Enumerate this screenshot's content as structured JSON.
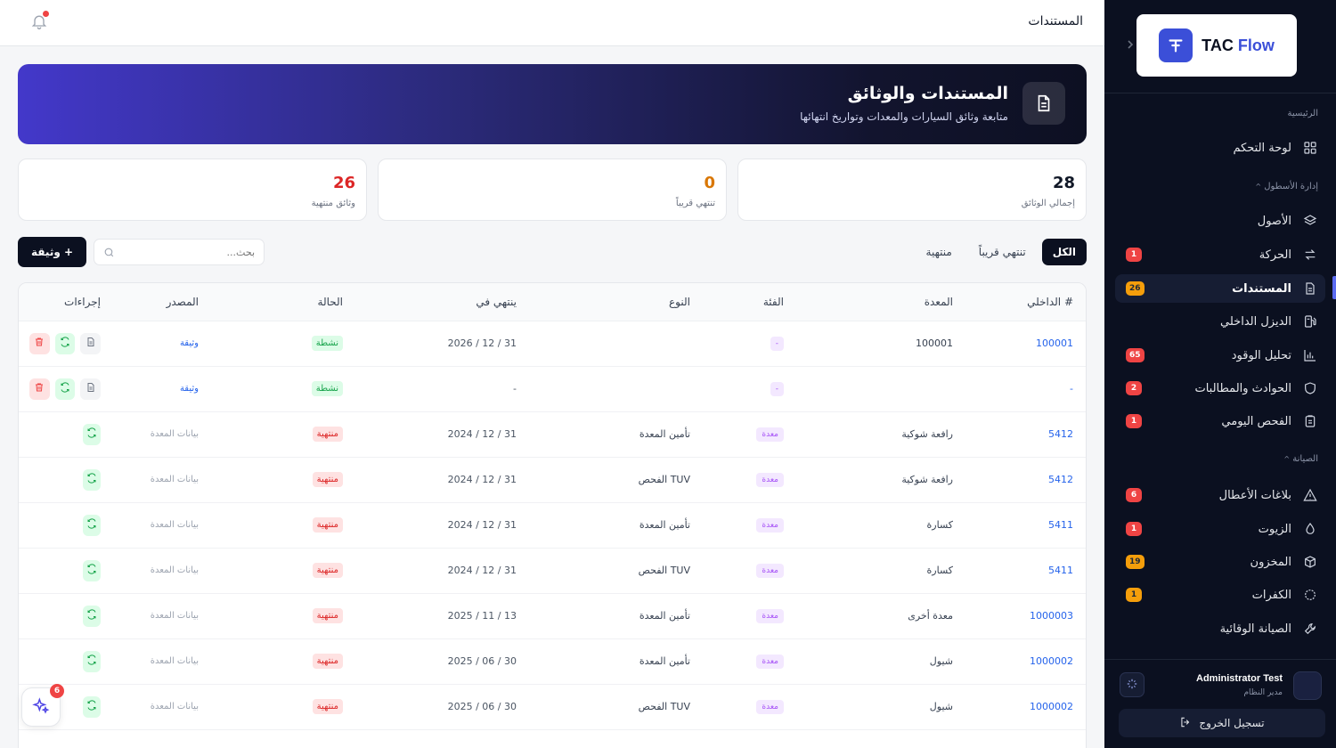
{
  "sidebar": {
    "logo": {
      "brand": "TAC",
      "product": "Flow"
    },
    "sections": {
      "home": "الرئيسية",
      "fleet": "إدارة الأسطول",
      "maintenance": "الصيانة"
    },
    "items": [
      {
        "label": "لوحة التحكم",
        "badge": "",
        "icon": "dashboard-icon"
      },
      {
        "label": "الأصول",
        "badge": "",
        "icon": "layers-icon"
      },
      {
        "label": "الحركة",
        "badge": "1",
        "icon": "transfer-icon"
      },
      {
        "label": "المستندات",
        "badge": "26",
        "icon": "document-icon"
      },
      {
        "label": "الديزل الداخلي",
        "badge": "",
        "icon": "fuel-icon"
      },
      {
        "label": "تحليل الوقود",
        "badge": "65",
        "icon": "bar-chart-icon"
      },
      {
        "label": "الحوادث والمطالبات",
        "badge": "2",
        "icon": "shield-icon"
      },
      {
        "label": "الفحص اليومي",
        "badge": "1",
        "icon": "clipboard-icon"
      },
      {
        "label": "بلاغات الأعطال",
        "badge": "6",
        "icon": "warning-icon"
      },
      {
        "label": "الزيوت",
        "badge": "1",
        "icon": "droplet-icon"
      },
      {
        "label": "المخزون",
        "badge": "19",
        "icon": "box-icon"
      },
      {
        "label": "الكفرات",
        "badge": "1",
        "icon": "tire-icon"
      },
      {
        "label": "الصيانة الوقائية",
        "badge": "",
        "icon": "wrench-icon"
      }
    ],
    "user": {
      "name": "Administrator Test",
      "role": "مدير النظام"
    },
    "logout": "تسجيل الخروج"
  },
  "header": {
    "title": "المستندات"
  },
  "hero": {
    "title": "المستندات والوثائق",
    "subtitle": "متابعة وثائق السيارات والمعدات وتواريخ انتهائها"
  },
  "stats": [
    {
      "value": "28",
      "label": "إجمالي الوثائق",
      "color": "#111827"
    },
    {
      "value": "0",
      "label": "تنتهي قريباً",
      "color": "#d97706"
    },
    {
      "value": "26",
      "label": "وثائق منتهية",
      "color": "#dc2626"
    }
  ],
  "filters": {
    "tabs": [
      "الكل",
      "تنتهي قريباً",
      "منتهية"
    ],
    "active": 0
  },
  "search": {
    "placeholder": "بحث..."
  },
  "add_button": "+ وثيقة",
  "table": {
    "headers": [
      "# الداخلي",
      "المعدة",
      "الفئة",
      "النوع",
      "ينتهي في",
      "الحالة",
      "المصدر",
      "إجراءات"
    ],
    "rows": [
      {
        "id": "100001",
        "equipment": "100001",
        "category": "-",
        "type": "",
        "expires": "31 / 12 / 2026",
        "status": "نشطة",
        "status_kind": "active",
        "source": "وثيقة",
        "source_kind": "doc"
      },
      {
        "id": "-",
        "equipment": "",
        "category": "-",
        "type": "",
        "expires": "-",
        "status": "نشطة",
        "status_kind": "active",
        "source": "وثيقة",
        "source_kind": "doc"
      },
      {
        "id": "5412",
        "equipment": "رافعة شوكية",
        "category": "معدة",
        "type": "تأمين المعدة",
        "expires": "31 / 12 / 2024",
        "status": "منتهية",
        "status_kind": "expired",
        "source": "بيانات المعدة",
        "source_kind": "equip"
      },
      {
        "id": "5412",
        "equipment": "رافعة شوكية",
        "category": "معدة",
        "type": "TUV الفحص",
        "expires": "31 / 12 / 2024",
        "status": "منتهية",
        "status_kind": "expired",
        "source": "بيانات المعدة",
        "source_kind": "equip"
      },
      {
        "id": "5411",
        "equipment": "كسارة",
        "category": "معدة",
        "type": "تأمين المعدة",
        "expires": "31 / 12 / 2024",
        "status": "منتهية",
        "status_kind": "expired",
        "source": "بيانات المعدة",
        "source_kind": "equip"
      },
      {
        "id": "5411",
        "equipment": "كسارة",
        "category": "معدة",
        "type": "TUV الفحص",
        "expires": "31 / 12 / 2024",
        "status": "منتهية",
        "status_kind": "expired",
        "source": "بيانات المعدة",
        "source_kind": "equip"
      },
      {
        "id": "1000003",
        "equipment": "معدة أخرى",
        "category": "معدة",
        "type": "تأمين المعدة",
        "expires": "13 / 11 / 2025",
        "status": "منتهية",
        "status_kind": "expired",
        "source": "بيانات المعدة",
        "source_kind": "equip"
      },
      {
        "id": "1000002",
        "equipment": "شيول",
        "category": "معدة",
        "type": "تأمين المعدة",
        "expires": "30 / 06 / 2025",
        "status": "منتهية",
        "status_kind": "expired",
        "source": "بيانات المعدة",
        "source_kind": "equip"
      },
      {
        "id": "1000002",
        "equipment": "شيول",
        "category": "معدة",
        "type": "TUV الفحص",
        "expires": "30 / 06 / 2025",
        "status": "منتهية",
        "status_kind": "expired",
        "source": "بيانات المعدة",
        "source_kind": "equip"
      }
    ]
  },
  "assistant": {
    "badge": "6"
  }
}
